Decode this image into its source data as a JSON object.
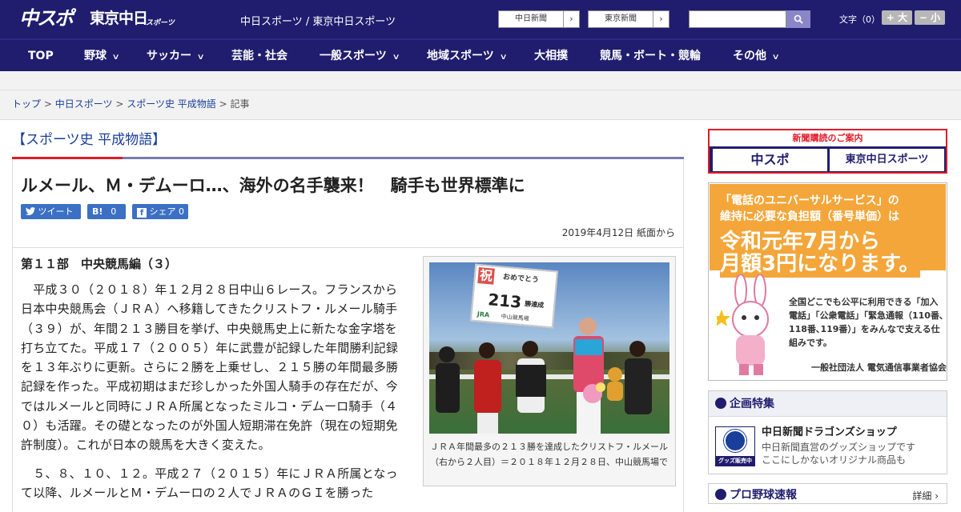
{
  "header": {
    "logo_chuspo": "中スポ",
    "logo_tokyo": "東京中日",
    "logo_tokyo_sub": "スポーツ",
    "site_names": "中日スポーツ / 東京中日スポーツ",
    "btn_chunichi": "中日新聞",
    "btn_tokyo": "東京新聞",
    "arrow": "›",
    "search_placeholder": "",
    "search_icon": "search-icon",
    "font_size_label": "文字（0）",
    "font_larger": "+ 大",
    "font_smaller": "− 小"
  },
  "nav": {
    "items": [
      "TOP",
      "野球",
      "サッカー",
      "芸能・社会",
      "一般スポーツ",
      "地域スポーツ",
      "大相撲",
      "競馬・ボート・競輪",
      "その他"
    ],
    "chevron": "∨"
  },
  "breadcrumb": {
    "top": "トップ",
    "sep": ">",
    "chunichi": "中日スポーツ",
    "series": "スポーツ史 平成物語",
    "current": "記事"
  },
  "article": {
    "section": "【スポーツ史 平成物語】",
    "title": "ルメール、Ｍ・デムーロ…、海外の名手襲来！　騎手も世界標準に",
    "share_tweet": "ツイート",
    "share_hatena": "B!",
    "share_hatena_count": "0",
    "share_fb": "シェア",
    "share_fb_count": "0",
    "date": "2019年4月12日 紙面から",
    "subtitle": "第１１部　中央競馬編（３）",
    "paragraph1": "　平成３０（２０１８）年１２月２８日中山６レース。フランスから日本中央競馬会（ＪＲＡ）へ移籍してきたクリストフ・ルメール騎手（３９）が、年間２１３勝目を挙げ、中央競馬史上に新たな金字塔を打ち立てた。平成１７（２００５）年に武豊が記録した年間勝利記録を１３年ぶりに更新。さらに２勝を上乗せし、２１５勝の年間最多勝記録を作った。平成初期はまだ珍しかった外国人騎手の存在だが、今ではルメールと同時にＪＲＡ所属となったミルコ・デムーロ騎手（４０）も活躍。その礎となったのが外国人短期滞在免許（現在の短期免許制度）。これが日本の競馬を大きく変えた。",
    "paragraph2": "　５、８、１０、１２。平成２７（２０１５）年にＪＲＡ所属となって以降、ルメールとＭ・デムーロの２人でＪＲＡのＧＩを勝った",
    "photo_sign_iwai": "祝",
    "photo_sign_omedetou": "おめでとう",
    "photo_sign_number": "213",
    "photo_sign_unit": "勝達成",
    "photo_sign_jra": "JRA",
    "photo_sign_venue": "中山競馬場",
    "caption": "ＪＲＡ年間最多の２１３勝を達成したクリストフ・ルメール（右から２人目）＝２０１８年１２月２８日、中山競馬場で"
  },
  "sidebar": {
    "subscribe_label": "新聞購読のご案内",
    "subscribe_chuspo": "中スポ",
    "subscribe_tokyo": "東京中日スポーツ",
    "ad_line1": "「電話のユニバーサルサービス」の",
    "ad_line2": "維持に必要な負担額（番号単価）は",
    "ad_line3": "令和元年7月から",
    "ad_line4": "月額3円になります。",
    "ad_body": "全国どこでも公平に利用できる「加入電話」「公衆電話」「緊急通報（110番､118番､119番）」をみんなで支える仕組みです。",
    "ad_org": "一般社団法人 電気通信事業者協会",
    "special_title": "企画特集",
    "shop_title": "中日新聞ドラゴンズショップ",
    "shop_text1": "中日新聞直営のグッズショップです",
    "shop_text2": "ここにしかないオリジナル商品も",
    "shop_badge": "グッズ販売中",
    "baseball_title": "プロ野球速報",
    "baseball_detail": "詳細 ›"
  }
}
